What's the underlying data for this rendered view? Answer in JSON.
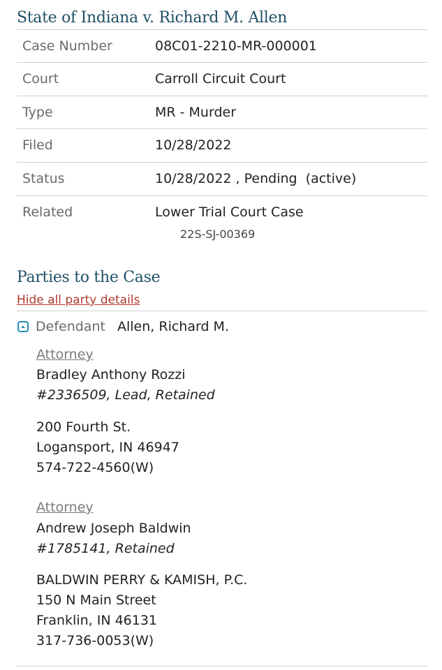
{
  "case": {
    "title": "State of Indiana v. Richard M. Allen",
    "details": [
      {
        "label": "Case Number",
        "value": "08C01-2210-MR-000001"
      },
      {
        "label": "Court",
        "value": "Carroll Circuit Court"
      },
      {
        "label": "Type",
        "value": "MR - Murder"
      },
      {
        "label": "Filed",
        "value": "10/28/2022"
      },
      {
        "label": "Status",
        "value": "10/28/2022 , Pending  (active)"
      },
      {
        "label": "Related",
        "value": "Lower Trial Court Case",
        "sub_value": "22S-SJ-00369"
      }
    ]
  },
  "parties": {
    "title": "Parties to the Case",
    "toggle_link": "Hide all party details",
    "toggle_icon": "collapse-icon",
    "accent_color": "#1f8fb3",
    "defendant": {
      "type_label": "Defendant",
      "name": "Allen, Richard M.",
      "attorneys": [
        {
          "heading": "Attorney",
          "name": "Bradley Anthony Rozzi",
          "id_role": "#2336509, Lead, Retained",
          "address": [
            "200 Fourth St.",
            "Logansport, IN 46947",
            "574-722-4560(W)"
          ]
        },
        {
          "heading": "Attorney",
          "name": "Andrew Joseph Baldwin",
          "id_role": "#1785141, Retained",
          "address": [
            "BALDWIN PERRY & KAMISH, P.C.",
            "150 N Main Street",
            "Franklin, IN 46131",
            "317-736-0053(W)"
          ]
        }
      ]
    }
  }
}
